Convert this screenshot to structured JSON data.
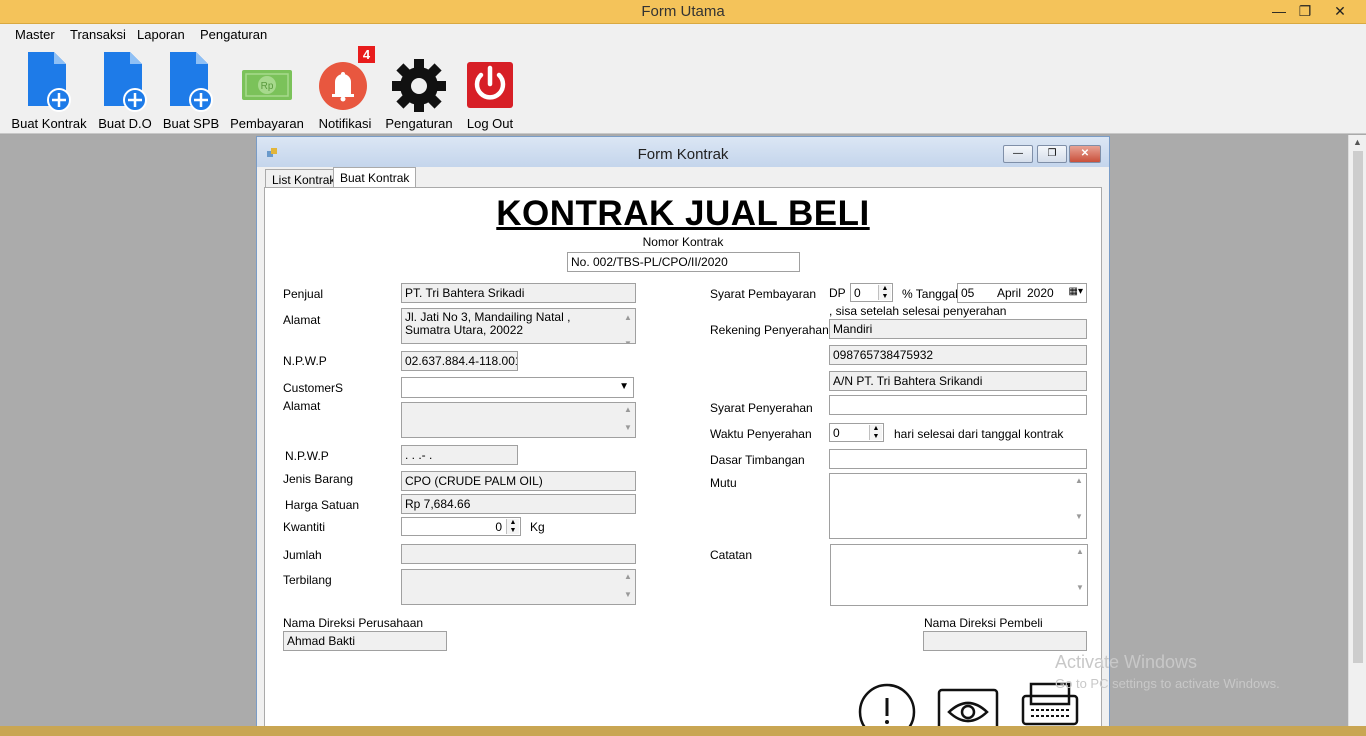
{
  "window": {
    "title": "Form Utama",
    "controls": {
      "minimize": "—",
      "restore": "❐",
      "close": "✕"
    }
  },
  "menu": [
    "Master",
    "Transaksi",
    "Laporan",
    "Pengaturan"
  ],
  "toolbar": {
    "buat_kontrak": "Buat Kontrak",
    "buat_do": "Buat D.O",
    "buat_spb": "Buat SPB",
    "pembayaran": "Pembayaran",
    "notifikasi": "Notifikasi",
    "notifikasi_badge": "4",
    "pengaturan": "Pengaturan",
    "log_out": "Log Out",
    "rp_symbol": "Rp"
  },
  "child": {
    "title": "Form Kontrak",
    "tabs": [
      "List Kontrak",
      "Buat Kontrak"
    ],
    "active_tab": "Buat Kontrak"
  },
  "form": {
    "heading": "KONTRAK JUAL BELI",
    "nomor_label": "Nomor Kontrak",
    "nomor_value": "No. 002/TBS-PL/CPO/II/2020",
    "penjual_label": "Penjual",
    "penjual_value": "PT. Tri Bahtera Srikadi",
    "alamat_label": "Alamat",
    "alamat_value": "Jl. Jati No 3, Mandailing Natal , Sumatra Utara, 20022",
    "npwp_label": "N.P.W.P",
    "npwp_value": "02.637.884.4-118.001",
    "customer_label": "CustomerS",
    "customer_value": "",
    "alamat2_label": "Alamat",
    "npwp2_label": "N.P.W.P",
    "npwp2_value": "  .   .   .-   .",
    "jenis_label": "Jenis Barang",
    "jenis_value": "CPO (CRUDE PALM OIL)",
    "harga_label": "Harga Satuan",
    "harga_value": "Rp 7,684.66",
    "kwantiti_label": "Kwantiti",
    "kwantiti_value": "0",
    "kg_label": "Kg",
    "jumlah_label": "Jumlah",
    "terbilang_label": "Terbilang",
    "syarat_bayar_label": "Syarat Pembayaran",
    "dp_label": "DP",
    "dp_value": "0",
    "tanggal_label": "% Tanggal",
    "tanggal_day": "05",
    "tanggal_month": "April",
    "tanggal_year": "2020",
    "sisa_label": ", sisa setelah selesai penyerahan",
    "rekening_label": "Rekening Penyerahan",
    "rekening_bank": "Mandiri",
    "rekening_no": "098765738475932",
    "rekening_an": "A/N PT. Tri Bahtera Srikandi",
    "syarat_serah_label": "Syarat Penyerahan",
    "waktu_label": "Waktu Penyerahan",
    "waktu_value": "0",
    "waktu_suffix": "hari selesai dari tanggal kontrak",
    "dasar_label": "Dasar Timbangan",
    "mutu_label": "Mutu",
    "catatan_label": "Catatan",
    "direksi_perusahaan_label": "Nama Direksi Perusahaan",
    "direksi_perusahaan_value": "Ahmad Bakti",
    "direksi_pembeli_label": "Nama Direksi Pembeli",
    "direksi_pembeli_value": ""
  },
  "watermark": {
    "line1": "Activate Windows",
    "line2": "Go to PC settings to activate Windows."
  },
  "colors": {
    "titlebar": "#f4c35a",
    "file_icon": "#1e7be8",
    "notif_bell": "#e8573f",
    "power": "#d71f26",
    "money": "#7bc25a"
  }
}
